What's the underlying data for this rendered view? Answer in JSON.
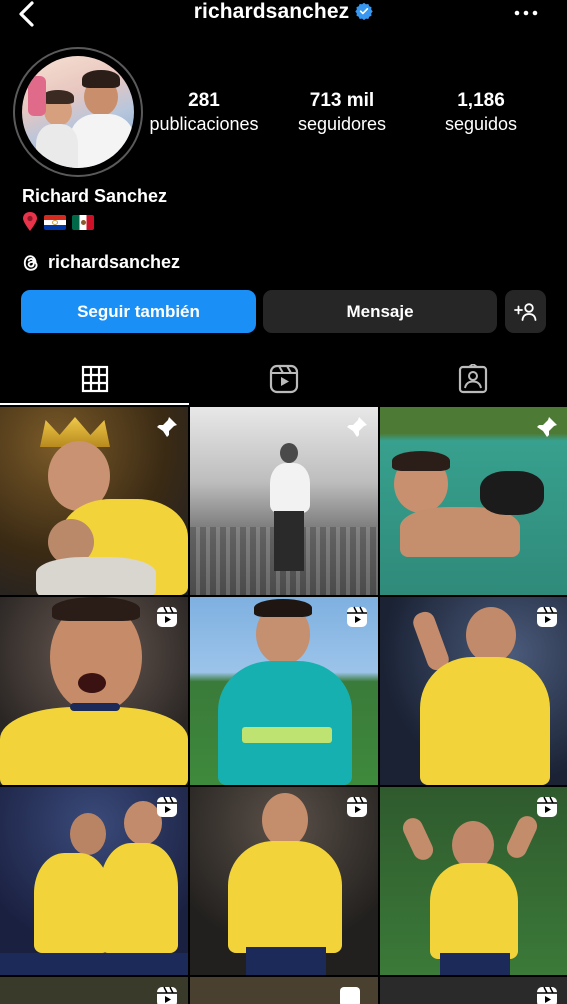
{
  "header": {
    "username": "richardsanchez",
    "verified": true
  },
  "profile": {
    "full_name": "Richard Sanchez",
    "threads_handle": "richardsanchez"
  },
  "stats": {
    "posts": {
      "value": "281",
      "label": "publicaciones"
    },
    "followers": {
      "value": "713 mil",
      "label": "seguidores"
    },
    "following": {
      "value": "1,186",
      "label": "seguidos"
    }
  },
  "actions": {
    "follow_label": "Seguir también",
    "message_label": "Mensaje"
  },
  "tabs": [
    {
      "name": "grid",
      "icon": "grid-icon",
      "active": true
    },
    {
      "name": "reels",
      "icon": "reels-icon",
      "active": false
    },
    {
      "name": "tagged",
      "icon": "tagged-icon",
      "active": false
    }
  ],
  "posts": [
    {
      "badge": "pinned",
      "scene": "trophy celebration with child, gold crown"
    },
    {
      "badge": "pinned",
      "scene": "black and white glass skydeck"
    },
    {
      "badge": "pinned",
      "scene": "pool with dog"
    },
    {
      "badge": "reel",
      "scene": "shouting in yellow jersey"
    },
    {
      "badge": "reel",
      "scene": "teal training jacket on pitch"
    },
    {
      "badge": "reel",
      "scene": "celebration with fans"
    },
    {
      "badge": "reel",
      "scene": "two players celebrating"
    },
    {
      "badge": "reel",
      "scene": "player shouting in yellow kit"
    },
    {
      "badge": "reel",
      "scene": "flexing arms on pitch"
    }
  ],
  "colors": {
    "accent": "#1a8ff5",
    "verified": "#3897f0",
    "kit_yellow": "#f2d43a",
    "button_dark": "#262626"
  }
}
